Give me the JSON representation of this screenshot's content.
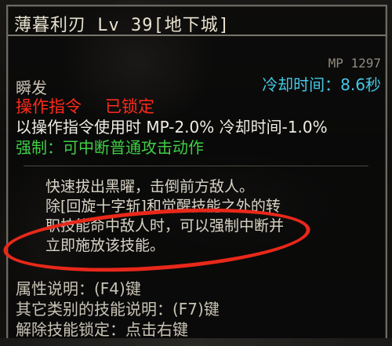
{
  "tooltip": {
    "title": "薄暮利刃 Lv 39[地下城]",
    "mp": "MP 1297",
    "cooldown": "冷却时间：8.6秒",
    "cast_type": "瞬发",
    "operation_label": "操作指令",
    "lock_label": "已锁定",
    "operation_effect": "以操作指令使用时 MP-2.0% 冷却时间-1.0%",
    "force": "强制：可中断普通攻击动作",
    "description": {
      "p1": "快速拔出黑曜，击倒前方敌人。",
      "p2": "除[回旋十字斩]和觉醒技能之外的转职技能命中敌人时，可以强制中断并立即施放该技能。"
    },
    "footer": {
      "attribute_help": "属性说明：(F4)键",
      "other_skills_help": "其它类别的技能说明：(F7)键",
      "unlock_help": "解除技能锁定：点击右键"
    }
  },
  "colors": {
    "title": "#e8e2cf",
    "cooldown": "#44c8e6",
    "locked": "#ff2a1a",
    "force": "#3fcf45",
    "highlight_oval": "#e8281a"
  }
}
